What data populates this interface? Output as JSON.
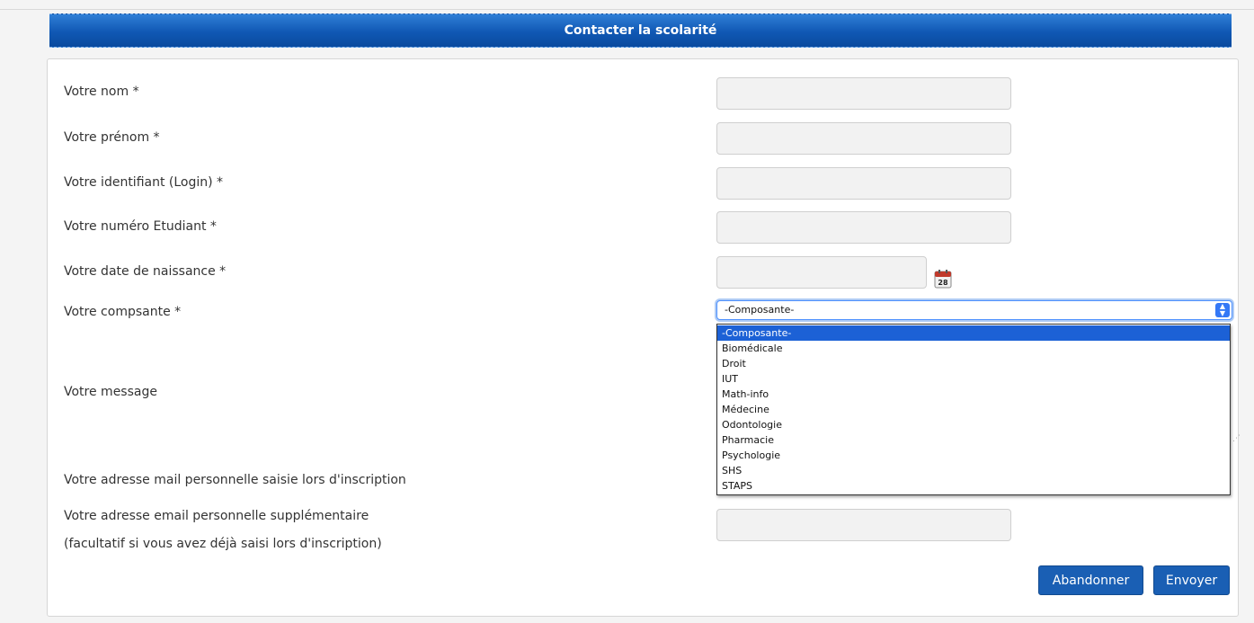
{
  "header": {
    "title": "Contacter la scolarité"
  },
  "form": {
    "nom_label": "Votre nom *",
    "prenom_label": "Votre prénom *",
    "login_label": "Votre identifiant (Login) *",
    "numero_label": "Votre numéro Etudiant *",
    "naissance_label": "Votre date de naissance *",
    "composante_label": "Votre compsante *",
    "message_label": "Votre message",
    "mail_label": "Votre adresse mail personnelle saisie lors d'inscription",
    "email_sup_label": "Votre adresse email personnelle supplémentaire",
    "email_sup_hint": "(facultatif si vous avez déjà saisi lors d'inscription)",
    "nom_value": "",
    "prenom_value": "",
    "login_value": "",
    "numero_value": "",
    "naissance_value": "",
    "email_sup_value": ""
  },
  "composante_select": {
    "selected": "-Composante-",
    "options": [
      "-Composante-",
      "Biomédicale",
      "Droit",
      "IUT",
      "Math-info",
      "Médecine",
      "Odontologie",
      "Pharmacie",
      "Psychologie",
      "SHS",
      "STAPS"
    ]
  },
  "calendar_icon": {
    "day": "28"
  },
  "buttons": {
    "cancel": "Abandonner",
    "submit": "Envoyer"
  },
  "colors": {
    "header": "#1058b4",
    "button": "#1a5fb4",
    "selected_option": "#1c61d6"
  }
}
